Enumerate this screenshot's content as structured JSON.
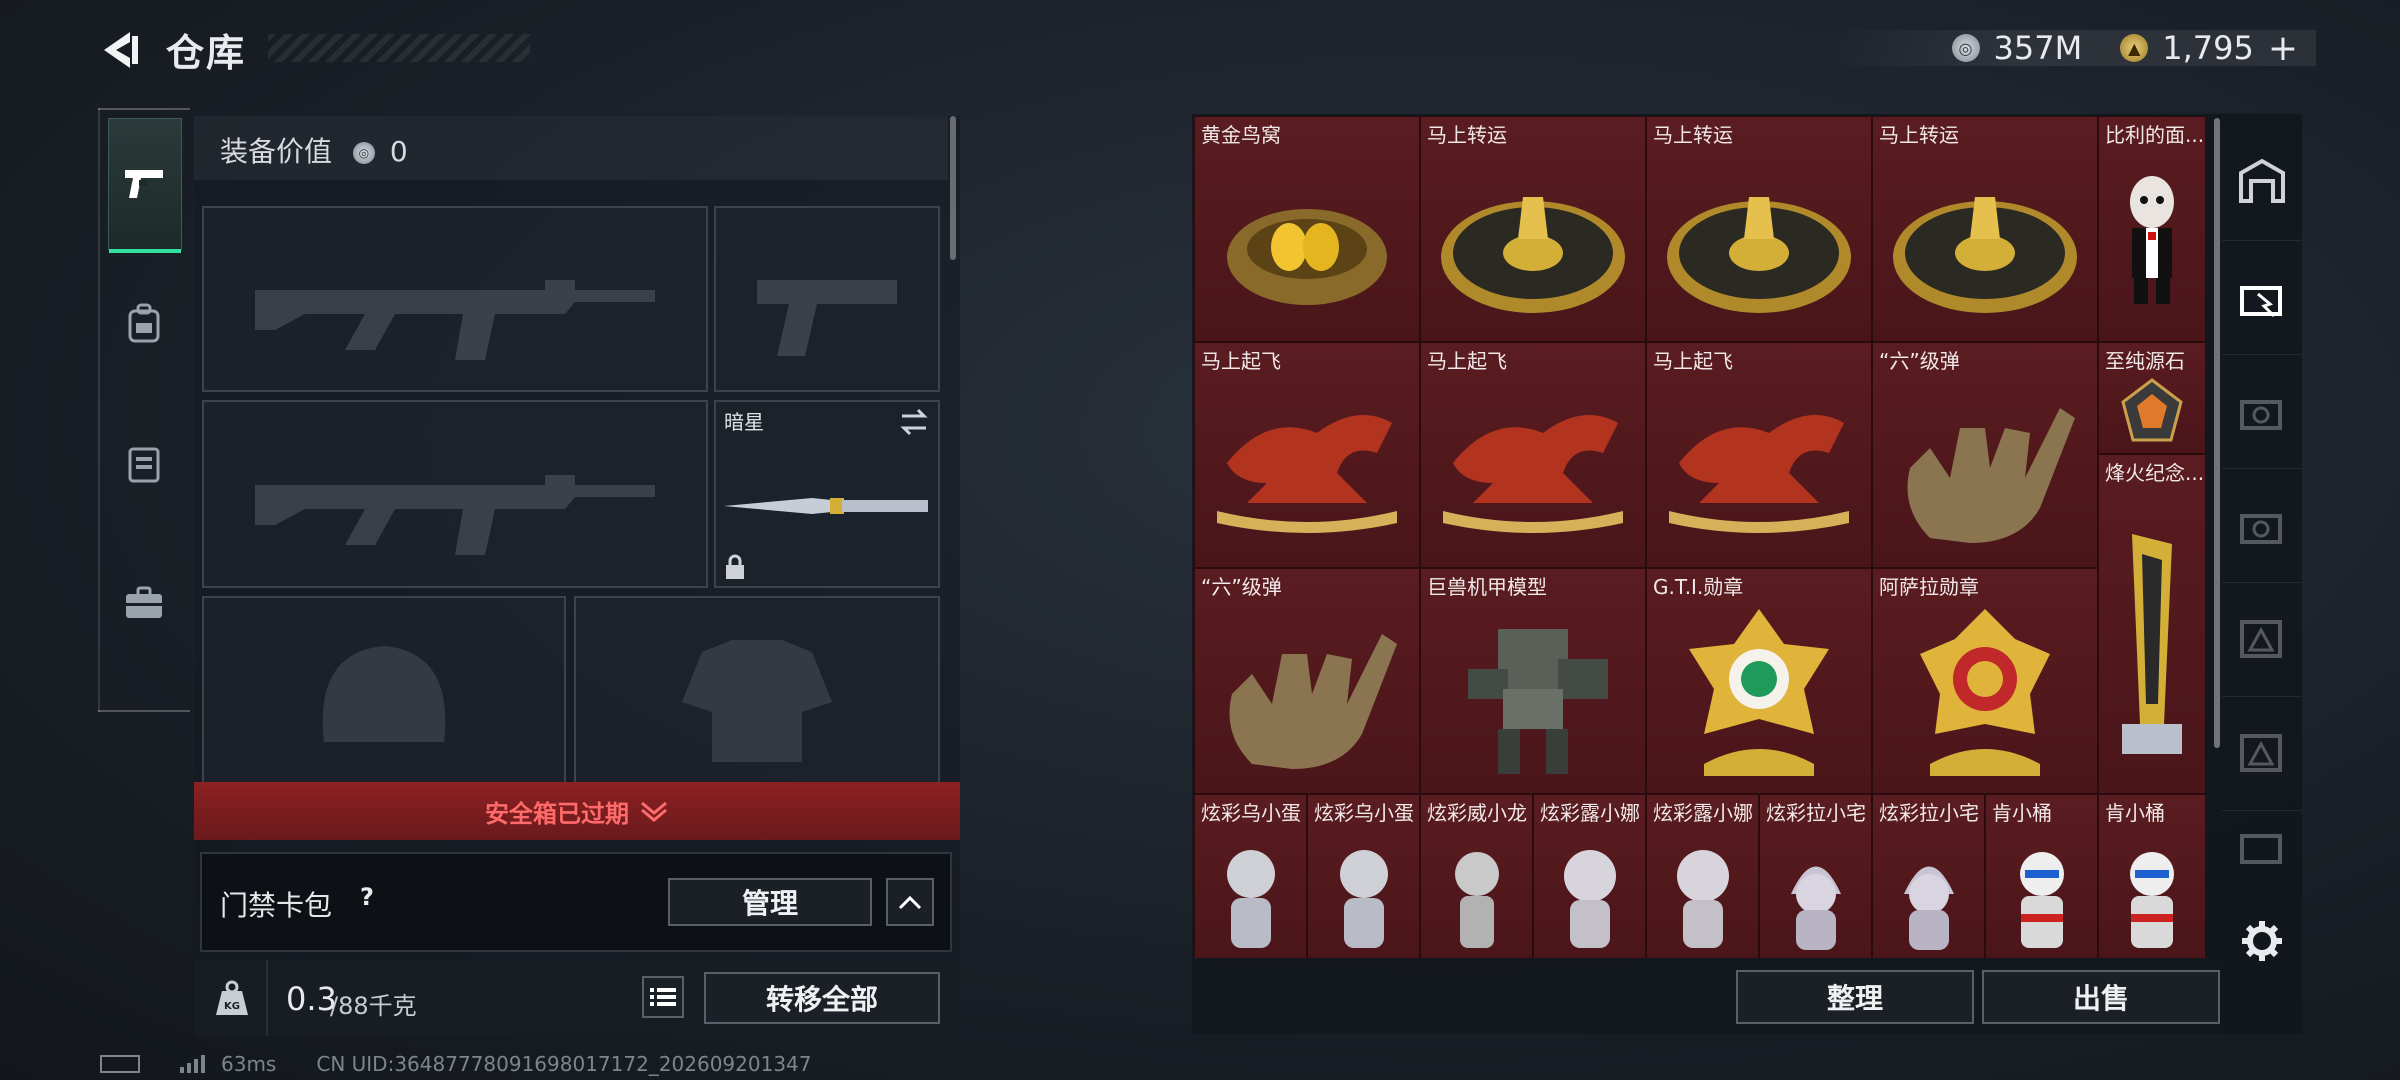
{
  "header": {
    "title": "仓库",
    "currency_silver": "357M",
    "currency_gold": "1,795",
    "plus": "+"
  },
  "equip": {
    "value_label": "装备价值",
    "value": "0",
    "melee_name": "暗星"
  },
  "safebox": {
    "status": "安全箱已过期"
  },
  "access": {
    "label": "门禁卡包",
    "help": "?",
    "manage": "管理"
  },
  "weight": {
    "current": "0.3",
    "capacity": "/88千克",
    "unit_icon": "KG",
    "transfer_all": "转移全部"
  },
  "inventory": {
    "items": [
      {
        "name": "黄金鸟窝"
      },
      {
        "name": "马上转运"
      },
      {
        "name": "马上转运"
      },
      {
        "name": "马上转运"
      },
      {
        "name": "比利的面..."
      },
      {
        "name": "马上起飞"
      },
      {
        "name": "马上起飞"
      },
      {
        "name": "马上起飞"
      },
      {
        "name": "“六”级弹"
      },
      {
        "name": "至纯源石"
      },
      {
        "name": "烽火纪念..."
      },
      {
        "name": "“六”级弹"
      },
      {
        "name": "巨兽机甲模型"
      },
      {
        "name": "G.T.I.勋章"
      },
      {
        "name": "阿萨拉勋章"
      },
      {
        "name": "炫彩乌小蛋"
      },
      {
        "name": "炫彩乌小蛋"
      },
      {
        "name": "炫彩威小龙"
      },
      {
        "name": "炫彩露小娜"
      },
      {
        "name": "炫彩露小娜"
      },
      {
        "name": "炫彩拉小宅"
      },
      {
        "name": "炫彩拉小宅"
      },
      {
        "name": "肯小桶"
      },
      {
        "name": "肯小桶"
      }
    ],
    "sort": "整理",
    "sell": "出售"
  },
  "footer": {
    "ping": "63ms",
    "uid": "CN UID:3648777809169801717​2_202609201347"
  },
  "colors": {
    "accent": "#33e0a0",
    "grid_red": "#5e1e22",
    "warning_red": "#ff6b6b"
  }
}
